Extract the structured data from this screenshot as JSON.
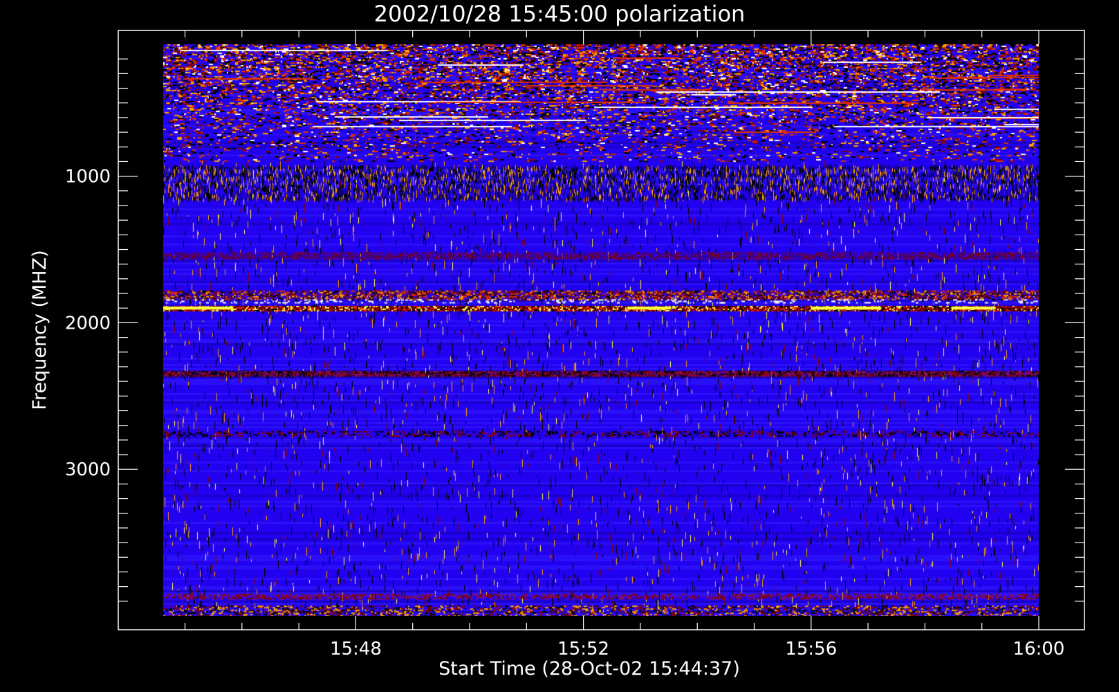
{
  "chart_data": {
    "type": "heatmap",
    "title": "2002/10/28 15:45:00 polarization",
    "xlabel": "Start Time (28-Oct-02 15:44:37)",
    "ylabel": "Frequency (MHZ)",
    "x_range": [
      "15:44:37",
      "16:00:00"
    ],
    "y_range_mhz": [
      100,
      4000
    ],
    "y_axis_reversed": true,
    "x_tick_labels": [
      "15:48",
      "15:52",
      "15:56",
      "16:00"
    ],
    "x_tick_values_min_since_start": [
      3.383,
      7.383,
      11.383,
      15.383
    ],
    "x_minor_tick_step_min": 1,
    "y_tick_labels": [
      "1000",
      "2000",
      "3000"
    ],
    "y_tick_values_mhz": [
      1000,
      2000,
      3000
    ],
    "y_minor_tick_step_mhz": 100,
    "color_scale": [
      "#000000",
      "#8a0000",
      "#e03000",
      "#ff9f00",
      "#ffff40",
      "#ffffff"
    ],
    "background_color": "#2200f0",
    "notable_bands_mhz": [
      {
        "from": 100,
        "to": 900,
        "note": "dense noisy band"
      },
      {
        "from": 1850,
        "to": 1920,
        "note": "strong band"
      },
      {
        "from": 2340,
        "to": 2360,
        "note": "dark red line"
      }
    ]
  }
}
